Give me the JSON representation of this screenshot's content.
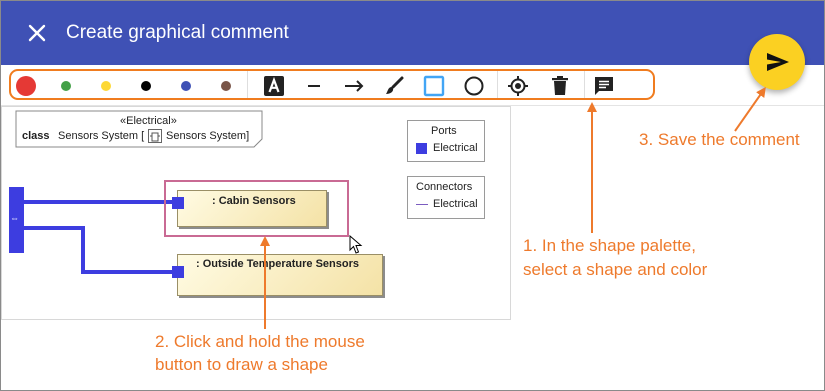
{
  "header": {
    "title": "Create graphical comment"
  },
  "colors": {
    "header_bg": "#3f51b5",
    "accent": "#ee7a2c",
    "fab": "#fbd022",
    "port": "#3d3de0",
    "selection": "#c96a94",
    "swatches": [
      "#e53935",
      "#43a047",
      "#fdd835",
      "#000000",
      "#3f51b5",
      "#795548"
    ]
  },
  "toolbar": {
    "swatches": [
      {
        "name": "red",
        "color": "#e53935",
        "selected": true
      },
      {
        "name": "green",
        "color": "#43a047"
      },
      {
        "name": "yellow",
        "color": "#fdd835"
      },
      {
        "name": "black",
        "color": "#000000"
      },
      {
        "name": "blue",
        "color": "#3f51b5"
      },
      {
        "name": "brown",
        "color": "#795548"
      }
    ],
    "shape_tools": [
      "text-icon",
      "line-icon",
      "arrow-icon",
      "brush-icon",
      "rectangle-icon",
      "circle-icon"
    ],
    "selected_shape": "rectangle-icon",
    "actions": [
      "locate-icon",
      "trash-icon",
      "comment-list-icon"
    ]
  },
  "diagram": {
    "stereotype": "«Electrical»",
    "class_keyword": "class",
    "class_name": "Sensors System [",
    "class_suffix": "Sensors System]",
    "parts": [
      {
        "label": ": Cabin Sensors"
      },
      {
        "label": ": Outside Temperature Sensors"
      }
    ],
    "legend_ports": {
      "title": "Ports",
      "item": "Electrical"
    },
    "legend_connectors": {
      "title": "Connectors",
      "item": "Electrical"
    }
  },
  "annotations": {
    "step1_line1": "1. In the shape palette,",
    "step1_line2": "select a shape and color",
    "step2_line1": "2. Click and hold the mouse",
    "step2_line2": "button to draw a shape",
    "step3": "3. Save the comment"
  }
}
